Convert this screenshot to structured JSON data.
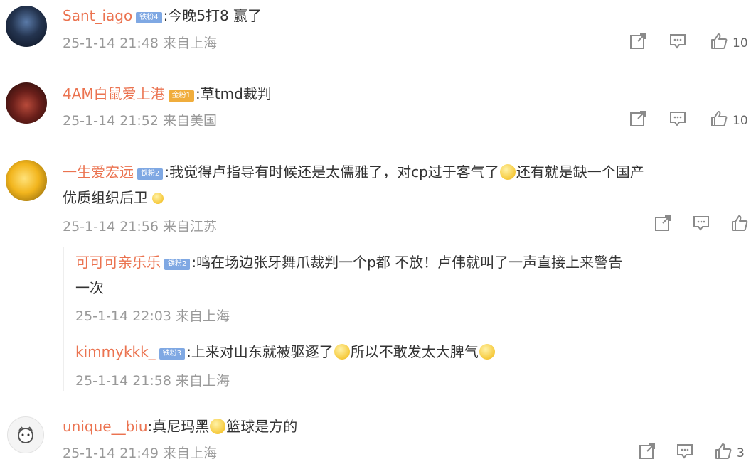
{
  "comments": [
    {
      "user": "Sant_iago",
      "badge": "铁粉4",
      "text": ":今晚5打8 赢了",
      "meta": "25-1-14 21:48 来自上海",
      "likes": "10"
    },
    {
      "user": "4AM白鼠爱上港",
      "badge": "金粉1",
      "text": ":草tmd裁判",
      "meta": "25-1-14 21:52 来自美国",
      "likes": "10"
    },
    {
      "user": "一生爱宏远",
      "badge": "铁粉2",
      "text_line1a": ":我觉得卢指导有时候还是太儒雅了，对cp过于客气了",
      "text_line1b": "还有就是缺一个国产",
      "text_line2": "优质组织后卫",
      "meta": "25-1-14 21:56 来自江苏",
      "replies": [
        {
          "user": "可可可亲乐乐",
          "badge": "铁粉2",
          "text_line1": ":鸣在场边张牙舞爪裁判一个p都  不放！卢伟就叫了一声直接上来警告",
          "text_line2": "一次",
          "meta": "25-1-14 22:03 来自上海"
        },
        {
          "user": "kimmykkk_",
          "badge": "铁粉3",
          "text_a": ":上来对山东就被驱逐了",
          "text_b": "所以不敢发太大脾气",
          "meta": "25-1-14 21:58 来自上海"
        }
      ]
    },
    {
      "user": "unique__biu",
      "text_a": ":真尼玛黑",
      "text_b": "篮球是方的",
      "meta": "25-1-14 21:49 来自上海",
      "likes": "3"
    }
  ],
  "icons": {
    "share": "share-icon",
    "comment": "comment-icon",
    "like": "thumbs-up-icon"
  }
}
